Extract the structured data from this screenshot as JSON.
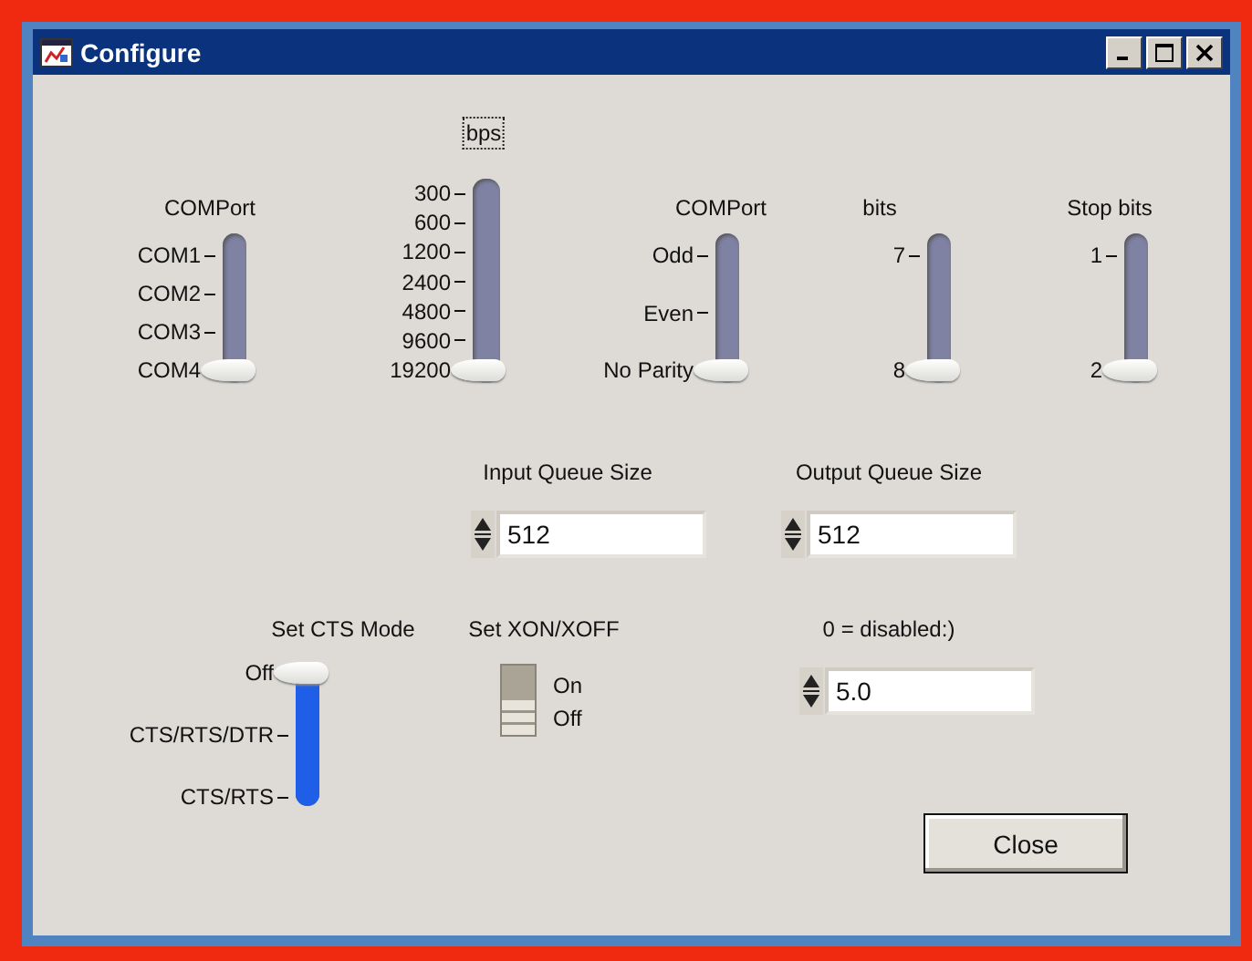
{
  "window": {
    "title": "Configure"
  },
  "sliders": [
    {
      "label": "COMPort",
      "label_focused": false,
      "ticks": [
        "COM1",
        "COM2",
        "COM3",
        "COM4"
      ],
      "level": 0
    },
    {
      "label": "bps",
      "label_focused": true,
      "ticks": [
        "300",
        "600",
        "1200",
        "2400",
        "4800",
        "9600",
        "19200"
      ],
      "level": 0
    },
    {
      "label": "COMPort",
      "label_focused": false,
      "ticks": [
        "Odd",
        "Even",
        "No Parity"
      ],
      "level": 0
    },
    {
      "label": "bits",
      "label_focused": false,
      "ticks": [
        "7",
        "8"
      ],
      "level": 0
    },
    {
      "label": "Stop bits",
      "label_focused": false,
      "ticks": [
        "1",
        "2"
      ],
      "level": 0
    },
    {
      "label": "Set CTS Mode",
      "label_focused": false,
      "ticks": [
        "Off",
        "CTS/RTS/DTR",
        "CTS/RTS"
      ],
      "level": 1
    }
  ],
  "numerics": [
    {
      "label": "Input Queue Size",
      "value": "512"
    },
    {
      "label": "Output Queue Size",
      "value": "512"
    },
    {
      "label": "0 = disabled:)",
      "value": "5.0"
    }
  ],
  "switch": {
    "label": "Set XON/XOFF",
    "options": [
      {
        "label": "On",
        "selected": false
      },
      {
        "label": "Off",
        "selected": true
      }
    ]
  },
  "buttons": [
    "Close"
  ]
}
